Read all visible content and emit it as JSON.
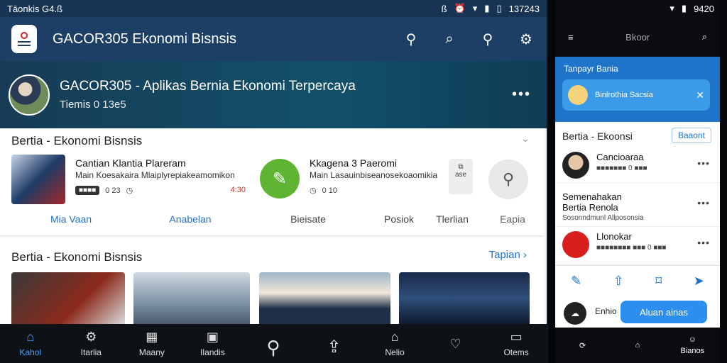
{
  "statusbar": {
    "left": "Tāonkis G4.ß",
    "time": "137243",
    "icons": [
      "bluetooth-icon",
      "alarm-icon",
      "wifi-icon",
      "signal-icon",
      "battery-icon"
    ]
  },
  "topbar": {
    "title": "GACOR305 Ekonomi Bisnsis"
  },
  "hero": {
    "title": "GACOR305 - Aplikas Bernia Ekonomi Terpercaya",
    "subtitle": "Tiemis 0 13e5"
  },
  "card1": {
    "header": "Bertia - Ekonomi Bisnsis",
    "item1": {
      "title": "Cantian Klantia Plareram",
      "subtitle": "Main Koesakaira Mlaiplyrepiakeamomikon",
      "pill": "■■■■",
      "count": "0 23",
      "time": "4:30"
    },
    "item2": {
      "title": "Kkagena 3 Paeromi",
      "subtitle": "Main Lasauinbiseanosekoaomikia",
      "count": "0 10",
      "share_label": "ase"
    },
    "tabs": [
      "Mia Vaan",
      "Anabelan",
      "Bieisate",
      "Posiok",
      "Tlerlian",
      "Eapia"
    ]
  },
  "section2": {
    "header": "Bertia - Ekonomi Bisnsis",
    "link": "Tapian ›"
  },
  "navbar": {
    "items": [
      "Kahol",
      "Itarlia",
      "Maany",
      "Ilandis",
      "",
      "",
      "Nelio",
      "",
      "Otems"
    ]
  },
  "phone": {
    "status_time": "9420",
    "top_title": "Bkoor",
    "blue_label": "Tanpayr Bania",
    "blue_item": "Binlrothia Sacsia",
    "list_header": "Bertia - Ekoonsi",
    "list_button": "Baaont",
    "rows": [
      {
        "name": "Cancioaraa",
        "sub": "■■■■■■■ 0 ■■■"
      },
      {
        "name": "Semenahakan Bertia Renola",
        "sub": "Sosonndmunl Allposonsia"
      },
      {
        "name": "Llonokar",
        "sub": "■■■■■■■■ ■■■ 0 ■■■"
      }
    ],
    "cta_label": "Enhio",
    "cta_button": "Aluan ainas",
    "nav_label": "Bianos"
  }
}
